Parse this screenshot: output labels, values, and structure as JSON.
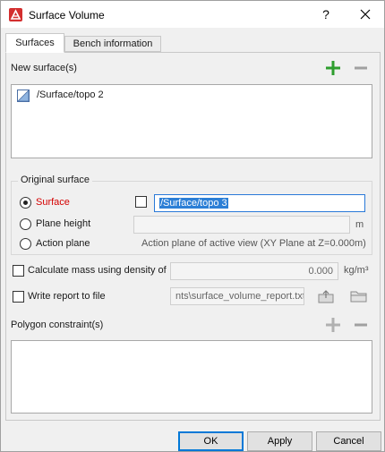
{
  "window": {
    "title": "Surface Volume",
    "help": "?"
  },
  "tabs": [
    {
      "label": "Surfaces"
    },
    {
      "label": "Bench information"
    }
  ],
  "new_surfaces": {
    "label": "New surface(s)",
    "items": [
      {
        "name": "/Surface/topo 2"
      }
    ]
  },
  "original_surface": {
    "group_label": "Original surface",
    "surface": {
      "label": "Surface",
      "value": "/Surface/topo 3",
      "selected": true
    },
    "plane_height": {
      "label": "Plane height",
      "value": "",
      "unit": "m"
    },
    "action_plane": {
      "label": "Action plane",
      "description": "Action plane of active view (XY Plane at Z=0.000m)"
    }
  },
  "mass": {
    "label": "Calculate mass using density of",
    "value": "0.000",
    "unit": "kg/m³"
  },
  "report": {
    "label": "Write report to file",
    "value": "nts\\surface_volume_report.txt"
  },
  "polygon": {
    "label": "Polygon constraint(s)"
  },
  "buttons": {
    "ok": "OK",
    "apply": "Apply",
    "cancel": "Cancel"
  },
  "colors": {
    "accent_blue": "#0078d7",
    "add_green": "#2e9e2e",
    "required_red": "#d40000",
    "selection": "#2c7fd6"
  }
}
